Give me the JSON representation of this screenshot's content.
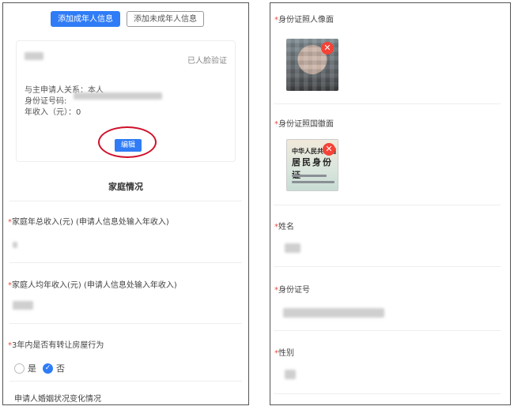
{
  "left": {
    "tabs": {
      "add_adult": "添加成年人信息",
      "add_minor": "添加未成年人信息"
    },
    "card": {
      "status": "已人脸验证",
      "relation": "与主申请人关系：本人",
      "id_label": "身份证号码:",
      "income": "年收入（元）：0",
      "edit_button": "编辑"
    },
    "section_title": "家庭情况",
    "fields": [
      {
        "required": "*",
        "label": "家庭年总收入(元) (申请人信息处输入年收入)"
      },
      {
        "required": "*",
        "label": "家庭人均年收入(元) (申请人信息处输入年收入)"
      },
      {
        "required": "*",
        "label": "3年内是否有转让房屋行为"
      }
    ],
    "radio": {
      "yes": "是",
      "no": "否",
      "checked_mark": "✓"
    },
    "marital_label": "申请人婚姻状况变化情况"
  },
  "right": {
    "labels": {
      "portrait": "身份证照人像面",
      "emblem": "身份证照国徽面",
      "name": "姓名",
      "id_number": "身份证号",
      "gender": "性别"
    },
    "required_mark": "*",
    "delete_mark": "✕",
    "emblem_card": {
      "line1": "中华人民共和国",
      "line2": "居民身份证"
    }
  },
  "colors": {
    "primary": "#2f7cf6",
    "required": "#e54d42",
    "highlight_circle": "#d0102a",
    "delete": "#f44336"
  }
}
